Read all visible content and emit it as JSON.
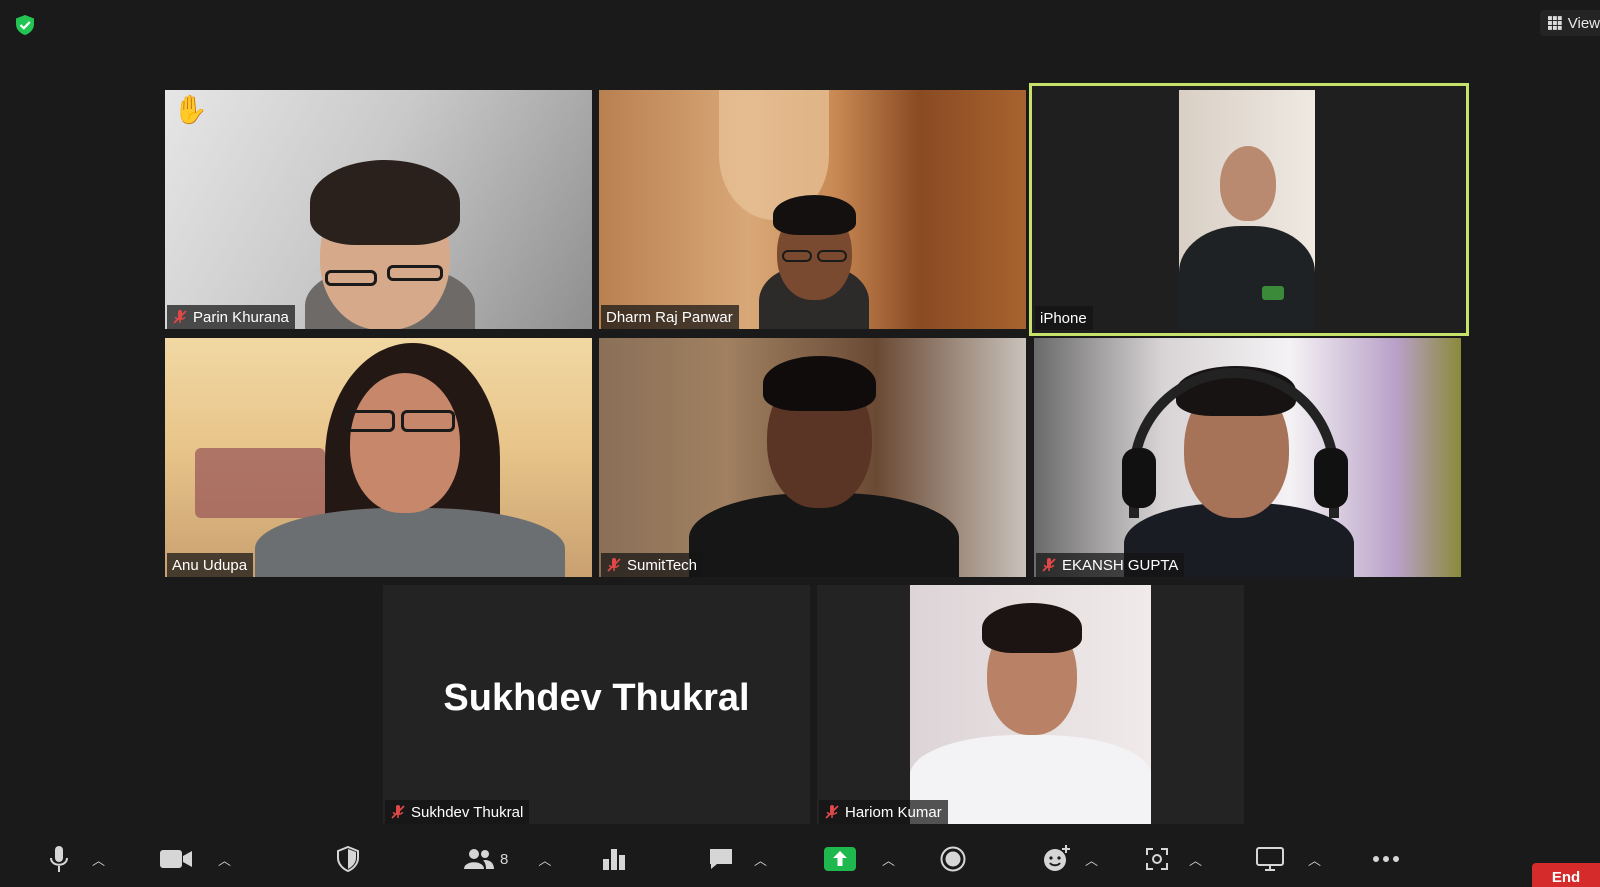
{
  "top": {
    "view_label": "View"
  },
  "participants": [
    {
      "name": "Parin Khurana",
      "muted": true,
      "hand_raised": true
    },
    {
      "name": "Dharm Raj Panwar",
      "muted": false
    },
    {
      "name": "iPhone",
      "muted": false,
      "active_speaker": true
    },
    {
      "name": "Anu Udupa",
      "muted": false
    },
    {
      "name": "SumitTech",
      "muted": true
    },
    {
      "name": "EKANSH GUPTA",
      "muted": true
    },
    {
      "name": "Sukhdev Thukral",
      "muted": true,
      "video_off": true,
      "display_name_large": "Sukhdev Thukral"
    },
    {
      "name": "Hariom Kumar",
      "muted": true
    }
  ],
  "toolbar": {
    "participants_count": "8",
    "end_label": "End",
    "icons": [
      "microphone-icon",
      "video-camera-icon",
      "security-shield-icon",
      "participants-icon",
      "polls-icon",
      "chat-icon",
      "share-screen-icon",
      "record-icon",
      "reactions-icon",
      "apps-icon",
      "whiteboard-icon",
      "more-icon"
    ]
  },
  "colors": {
    "active_speaker_border": "#c7e26a",
    "share_green": "#1fb84e",
    "end_red": "#d52b2b",
    "background": "#1a1a1a",
    "encryption_green": "#23c552"
  }
}
